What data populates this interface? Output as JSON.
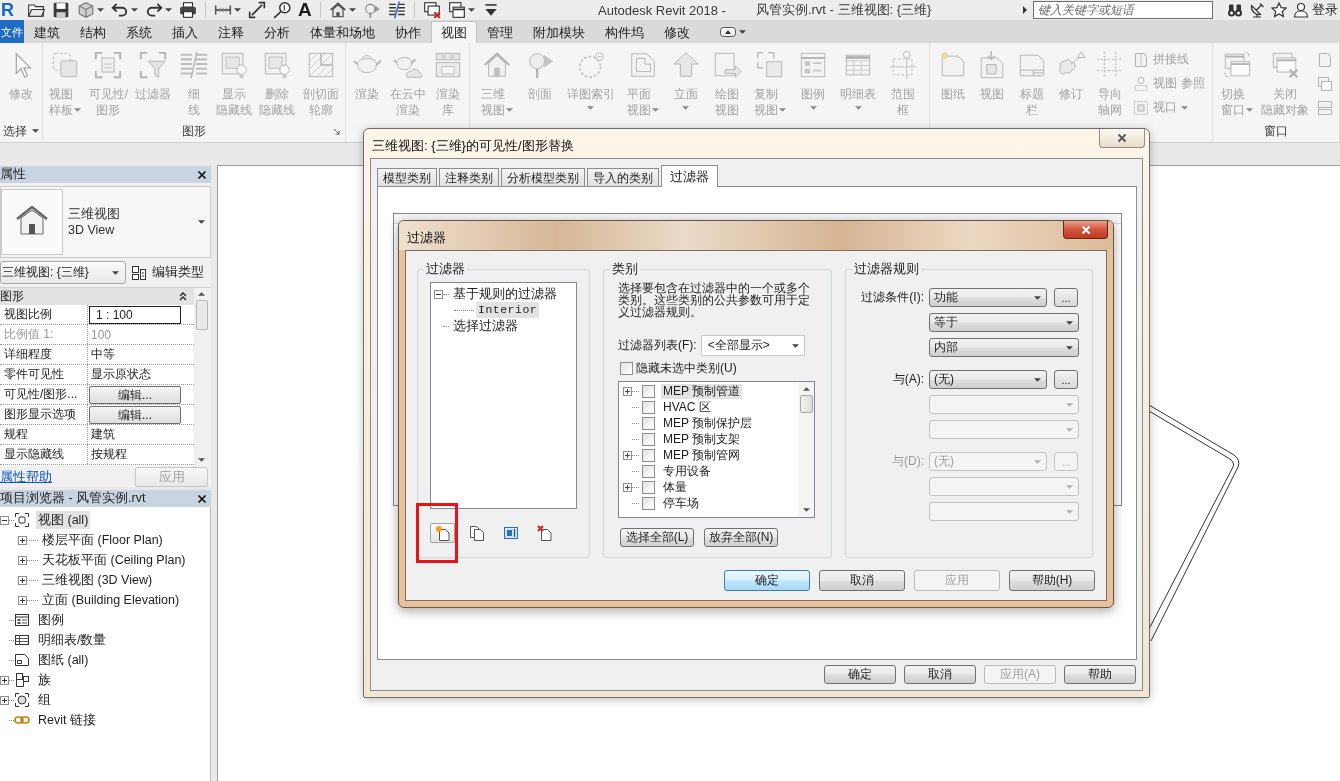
{
  "app": {
    "logo": "R",
    "title_app": "Autodesk Revit 2018 -",
    "title_doc": "风管实例.rvt - 三维视图: {三维}",
    "search": {
      "placeholder": "键入关键字或短语"
    },
    "sign_in": "登录"
  },
  "quick_access": [
    [
      {
        "kind": "icon",
        "caret": false
      },
      {
        "kind": "icon",
        "caret": false
      },
      {
        "kind": "icon",
        "caret": true
      },
      {
        "kind": "icon",
        "caret": true
      },
      {
        "kind": "icon",
        "caret": true
      },
      {
        "kind": "icon",
        "caret": false
      }
    ],
    [
      {
        "kind": "icon",
        "caret": true
      },
      {
        "kind": "icon",
        "caret": false
      },
      {
        "kind": "icon",
        "caret": false
      },
      {
        "kind": "glyph",
        "glyph": "A",
        "caret": false
      }
    ],
    [
      {
        "kind": "icon",
        "caret": true
      },
      {
        "kind": "icon",
        "caret": false
      },
      {
        "kind": "icon",
        "caret": false
      }
    ],
    [
      {
        "kind": "icon",
        "caret": false
      },
      {
        "kind": "icon",
        "caret": true
      },
      {
        "kind": "icon",
        "caret": false
      }
    ]
  ],
  "ribbon_tabs": [
    {
      "label": "文件",
      "kind": "application",
      "selected": false
    },
    {
      "label": "建筑",
      "kind": "tab",
      "selected": false
    },
    {
      "label": "结构",
      "kind": "tab",
      "selected": false
    },
    {
      "label": "系统",
      "kind": "tab",
      "selected": false
    },
    {
      "label": "插入",
      "kind": "tab",
      "selected": false
    },
    {
      "label": "注释",
      "kind": "tab",
      "selected": false
    },
    {
      "label": "分析",
      "kind": "tab",
      "selected": false
    },
    {
      "label": "体量和场地",
      "kind": "tab",
      "selected": false
    },
    {
      "label": "协作",
      "kind": "tab",
      "selected": false
    },
    {
      "label": "视图",
      "kind": "tab",
      "selected": true
    },
    {
      "label": "管理",
      "kind": "tab",
      "selected": false
    },
    {
      "label": "附加模块",
      "kind": "tab",
      "selected": false
    },
    {
      "label": "构件坞",
      "kind": "tab",
      "selected": false
    },
    {
      "label": "修改",
      "kind": "tab",
      "selected": false
    }
  ],
  "ribbon": {
    "disabled": true,
    "panels": [
      {
        "label": "选择",
        "menu": true,
        "launcher": false,
        "items": [
          {
            "kind": "large",
            "lines": [
              "修改"
            ],
            "menu": false
          }
        ]
      },
      {
        "label": "图形",
        "menu": false,
        "launcher": true,
        "items": [
          {
            "kind": "large",
            "lines": [
              "视图",
              "样板"
            ],
            "menu": true
          },
          {
            "kind": "large",
            "lines": [
              "可见性/",
              "图形"
            ],
            "menu": false
          },
          {
            "kind": "large",
            "lines": [
              "过滤器"
            ],
            "menu": false
          },
          {
            "kind": "large",
            "lines": [
              "细",
              "线"
            ],
            "menu": false
          },
          {
            "kind": "large",
            "lines": [
              "显示",
              "隐藏线"
            ],
            "menu": false
          },
          {
            "kind": "large",
            "lines": [
              "删除",
              "隐藏线"
            ],
            "menu": false
          },
          {
            "kind": "large",
            "lines": [
              "剖切面",
              "轮廓"
            ],
            "menu": false
          }
        ]
      },
      {
        "items": [
          {
            "kind": "large",
            "lines": [
              "渲染"
            ],
            "menu": false
          },
          {
            "kind": "large",
            "lines": [
              "在云中",
              "渲染"
            ],
            "menu": false
          },
          {
            "kind": "large",
            "lines": [
              "渲染",
              "库"
            ],
            "menu": false
          }
        ]
      },
      {
        "items": [
          {
            "kind": "large",
            "lines": [
              "三维",
              "视图"
            ],
            "menu": true
          },
          {
            "kind": "large",
            "lines": [
              "剖面"
            ],
            "menu": false
          },
          {
            "kind": "large",
            "lines": [
              "详图索引"
            ],
            "menu": true
          },
          {
            "kind": "large",
            "lines": [
              "平面",
              "视图"
            ],
            "menu": true
          },
          {
            "kind": "large",
            "lines": [
              "立面"
            ],
            "menu": true
          },
          {
            "kind": "large",
            "lines": [
              "绘图",
              "视图"
            ],
            "menu": false
          },
          {
            "kind": "large",
            "lines": [
              "复制",
              "视图"
            ],
            "menu": true
          },
          {
            "kind": "large",
            "lines": [
              "图例"
            ],
            "menu": true
          },
          {
            "kind": "large",
            "lines": [
              "明细表"
            ],
            "menu": true
          },
          {
            "kind": "large",
            "lines": [
              "范围",
              "框"
            ],
            "menu": false
          }
        ]
      },
      {
        "items": [
          {
            "kind": "large",
            "lines": [
              "图纸"
            ],
            "menu": false
          },
          {
            "kind": "large",
            "lines": [
              "视图"
            ],
            "menu": false
          },
          {
            "kind": "large",
            "lines": [
              "标题",
              "栏"
            ],
            "menu": false
          },
          {
            "kind": "large",
            "lines": [
              "修订"
            ],
            "menu": false
          },
          {
            "kind": "large",
            "lines": [
              "导向",
              "轴网"
            ],
            "menu": false
          },
          {
            "kind": "stack",
            "rows": [
              {
                "label": "拼接线",
                "menu": false
              },
              {
                "label": "视图 参照",
                "menu": false
              },
              {
                "label": "视口",
                "menu": true
              }
            ]
          }
        ]
      },
      {
        "label": "窗口",
        "menu": false,
        "launcher": false,
        "items": [
          {
            "kind": "large",
            "lines": [
              "切换",
              "窗口"
            ],
            "menu": true
          },
          {
            "kind": "large",
            "lines": [
              "关闭",
              "隐藏对象"
            ],
            "menu": false
          },
          {
            "kind": "stack",
            "rows": [
              {
                "menu": false
              },
              {
                "menu": false
              },
              {
                "menu": false
              }
            ]
          }
        ]
      }
    ]
  },
  "properties": {
    "title": "属性",
    "type_name": "三维视图",
    "type_name_en": "3D View",
    "instance": "三维视图: {三维}",
    "edit_type": "编辑类型",
    "group": {
      "label": "图形",
      "expanded": true
    },
    "rows": [
      {
        "name": "视图比例",
        "value": "1 : 100",
        "kind": "input",
        "disabled": false
      },
      {
        "name": "比例值 1:",
        "value": "100",
        "kind": "text",
        "disabled": true
      },
      {
        "name": "详细程度",
        "value": "中等",
        "kind": "text",
        "disabled": false
      },
      {
        "name": "零件可见性",
        "value": "显示原状态",
        "kind": "text",
        "disabled": false
      },
      {
        "name": "可见性/图形...",
        "value": "编辑...",
        "kind": "button",
        "disabled": false
      },
      {
        "name": "图形显示选项",
        "value": "编辑...",
        "kind": "button",
        "disabled": false
      },
      {
        "name": "规程",
        "value": "建筑",
        "kind": "text",
        "disabled": false
      },
      {
        "name": "显示隐藏线",
        "value": "按规程",
        "kind": "text",
        "disabled": false
      }
    ],
    "help_link": "属性帮助",
    "apply": {
      "label": "应用",
      "disabled": true
    }
  },
  "project_browser": {
    "title": "项目浏览器 - 风管实例.rvt",
    "items": [
      {
        "label": "视图 (all)",
        "expanded": true,
        "selected": true,
        "children": [
          {
            "label": "楼层平面 (Floor Plan)",
            "expanded": false,
            "selected": false
          },
          {
            "label": "天花板平面 (Ceiling Plan)",
            "expanded": false,
            "selected": false
          },
          {
            "label": "三维视图 (3D View)",
            "expanded": false,
            "selected": false
          },
          {
            "label": "立面 (Building Elevation)",
            "expanded": false,
            "selected": false
          }
        ]
      },
      {
        "label": "图例",
        "selected": false
      },
      {
        "label": "明细表/数量",
        "selected": false
      },
      {
        "label": "图纸 (all)",
        "selected": false
      },
      {
        "label": "族",
        "expanded": false,
        "selected": false
      },
      {
        "label": "组",
        "expanded": false,
        "selected": false
      },
      {
        "label": "Revit 链接",
        "selected": false
      }
    ]
  },
  "visibility_dialog": {
    "title": "三维视图: {三维}的可见性/图形替换",
    "tabs": [
      {
        "label": "模型类别",
        "selected": false
      },
      {
        "label": "注释类别",
        "selected": false
      },
      {
        "label": "分析模型类别",
        "selected": false
      },
      {
        "label": "导入的类别",
        "selected": false
      },
      {
        "label": "过滤器",
        "selected": true
      }
    ],
    "buttons": [
      {
        "label": "确定",
        "disabled": false
      },
      {
        "label": "取消",
        "disabled": false
      },
      {
        "label": "应用(A)",
        "disabled": true
      },
      {
        "label": "帮助",
        "disabled": false
      }
    ]
  },
  "filters_dialog": {
    "title": "过滤器",
    "filters": {
      "label": "过滤器",
      "tree": [
        {
          "label": "基于规则的过滤器",
          "expanded": true,
          "selected": false,
          "children": [
            {
              "label": "Interior",
              "selected": true
            }
          ]
        },
        {
          "label": "选择过滤器",
          "selected": false
        }
      ],
      "tools": [
        {
          "highlighted": true,
          "circled": true
        },
        {
          "highlighted": false,
          "circled": false
        },
        {
          "highlighted": false,
          "circled": false
        },
        {
          "highlighted": false,
          "circled": false
        }
      ]
    },
    "categories": {
      "label": "类别",
      "description": "选择要包含在过滤器中的一个或多个类别。这些类别的公共参数可用于定义过滤器规则。",
      "list_label": "过滤器列表(F):",
      "list_value": "<全部显示>",
      "hide_unchecked": {
        "label": "隐藏未选中类别(U)",
        "checked": false
      },
      "items": [
        {
          "label": "MEP 预制管道",
          "expanded": false,
          "checked": false,
          "selected": true
        },
        {
          "label": "HVAC 区",
          "checked": false,
          "selected": false
        },
        {
          "label": "MEP 预制保护层",
          "checked": false,
          "selected": false
        },
        {
          "label": "MEP 预制支架",
          "checked": false,
          "selected": false
        },
        {
          "label": "MEP 预制管网",
          "expanded": false,
          "checked": false,
          "selected": false
        },
        {
          "label": "专用设备",
          "checked": false,
          "selected": false
        },
        {
          "label": "体量",
          "expanded": false,
          "checked": false,
          "selected": false
        },
        {
          "label": "停车场",
          "checked": false,
          "selected": false
        }
      ],
      "buttons": [
        "选择全部(L)",
        "放弃全部(N)"
      ]
    },
    "rules": {
      "label": "过滤器规则",
      "groups": [
        [
          {
            "label": "过滤条件(I):",
            "value": "功能",
            "more": "...",
            "disabled": false
          },
          {
            "value": "等于",
            "disabled": false
          },
          {
            "value": "内部",
            "disabled": false
          }
        ],
        [
          {
            "label": "与(A):",
            "value": "(无)",
            "more": "...",
            "disabled": false
          },
          {
            "disabled": true
          },
          {
            "disabled": true
          }
        ],
        [
          {
            "label": "与(D):",
            "value": "(无)",
            "more": "...",
            "disabled": true
          },
          {
            "disabled": true
          },
          {
            "disabled": true
          }
        ]
      ]
    },
    "buttons": [
      {
        "label": "确定",
        "default": true,
        "disabled": false
      },
      {
        "label": "取消",
        "default": false,
        "disabled": false
      },
      {
        "label": "应用",
        "default": false,
        "disabled": true
      },
      {
        "label": "帮助(H)",
        "default": false,
        "disabled": false
      }
    ]
  }
}
